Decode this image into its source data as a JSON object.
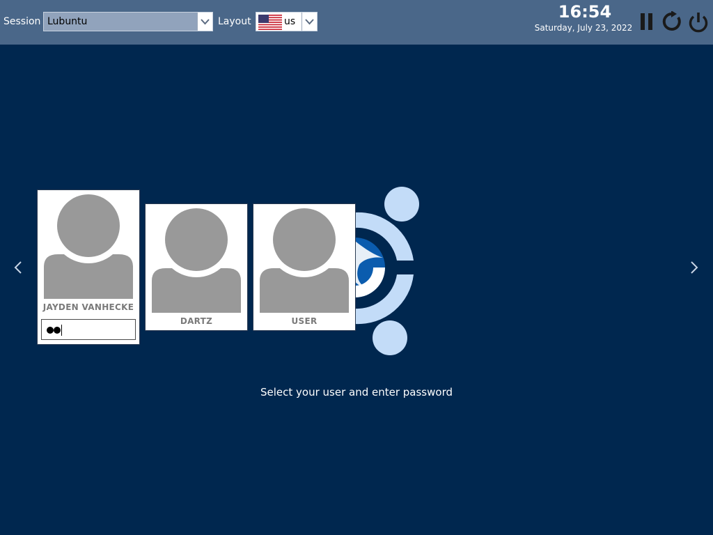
{
  "topbar": {
    "session_label": "Session",
    "session_value": "Lubuntu",
    "layout_label": "Layout",
    "layout_value": "us",
    "time": "16:54",
    "date": "Saturday, July 23, 2022"
  },
  "icons": {
    "suspend": "pause-icon",
    "reboot": "restart-icon",
    "shutdown": "power-icon",
    "prev": "chevron-left-icon",
    "next": "chevron-right-icon",
    "flag": "us-flag-icon"
  },
  "users": [
    {
      "name": "JAYDEN VANHECKE",
      "selected": true,
      "password_dots": 2
    },
    {
      "name": "DARTZ",
      "selected": false
    },
    {
      "name": "USER",
      "selected": false
    }
  ],
  "prompt": "Select your user and enter password",
  "colors": {
    "background": "#00274f",
    "topbar": "#4a6789",
    "avatar": "#999999",
    "logo_light": "#c3dcf8",
    "logo_mid": "#0b5cae"
  }
}
